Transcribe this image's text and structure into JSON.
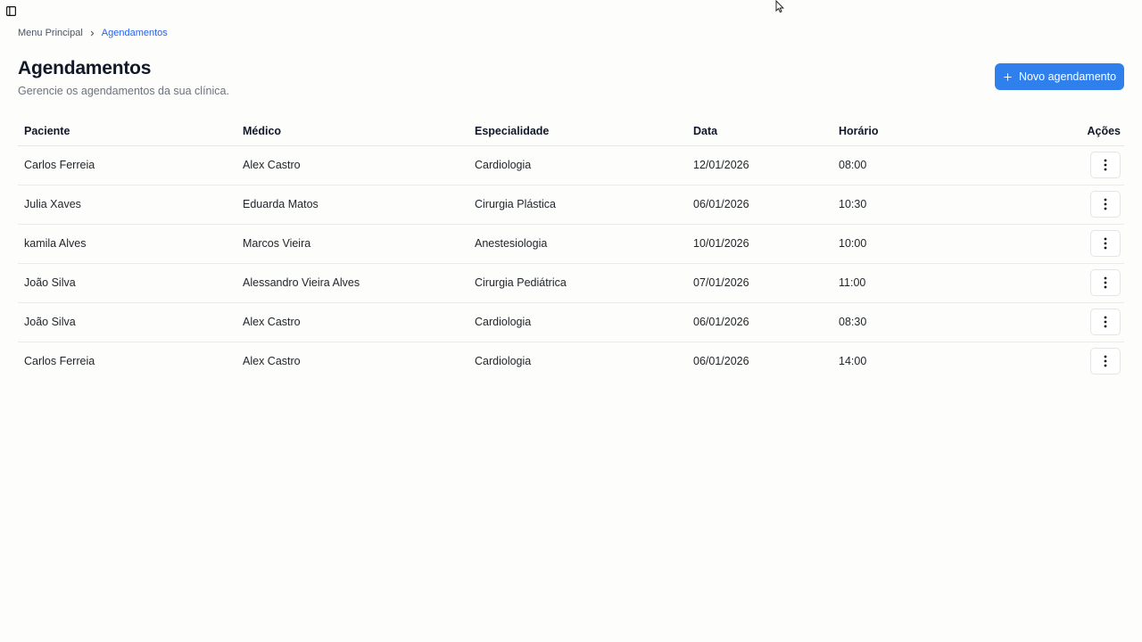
{
  "breadcrumb": {
    "root": "Menu Principal",
    "current": "Agendamentos"
  },
  "header": {
    "title": "Agendamentos",
    "subtitle": "Gerencie os agendamentos da sua clínica.",
    "new_button_label": "Novo agendamento"
  },
  "table": {
    "columns": {
      "paciente": "Paciente",
      "medico": "Médico",
      "especialidade": "Especialidade",
      "data": "Data",
      "horario": "Horário",
      "acoes": "Ações"
    },
    "rows": [
      {
        "paciente": "Carlos Ferreia",
        "medico": "Alex Castro",
        "especialidade": "Cardiologia",
        "data": "12/01/2026",
        "horario": "08:00"
      },
      {
        "paciente": "Julia Xaves",
        "medico": "Eduarda Matos",
        "especialidade": "Cirurgia Plástica",
        "data": "06/01/2026",
        "horario": "10:30"
      },
      {
        "paciente": "kamila Alves",
        "medico": "Marcos Vieira",
        "especialidade": "Anestesiologia",
        "data": "10/01/2026",
        "horario": "10:00"
      },
      {
        "paciente": "João Silva",
        "medico": "Alessandro Vieira Alves",
        "especialidade": "Cirurgia Pediátrica",
        "data": "07/01/2026",
        "horario": "11:00"
      },
      {
        "paciente": "João Silva",
        "medico": "Alex Castro",
        "especialidade": "Cardiologia",
        "data": "06/01/2026",
        "horario": "08:30"
      },
      {
        "paciente": "Carlos Ferreia",
        "medico": "Alex Castro",
        "especialidade": "Cardiologia",
        "data": "06/01/2026",
        "horario": "14:00"
      }
    ]
  },
  "icons": {
    "sidebar_toggle": "panel-left-icon",
    "breadcrumb_separator": "chevron-right-icon",
    "new_button": "plus-icon",
    "row_actions": "more-vertical-icon"
  },
  "colors": {
    "accent": "#2f80ed",
    "breadcrumb_current": "#2563eb",
    "background": "#fdfdfc"
  }
}
